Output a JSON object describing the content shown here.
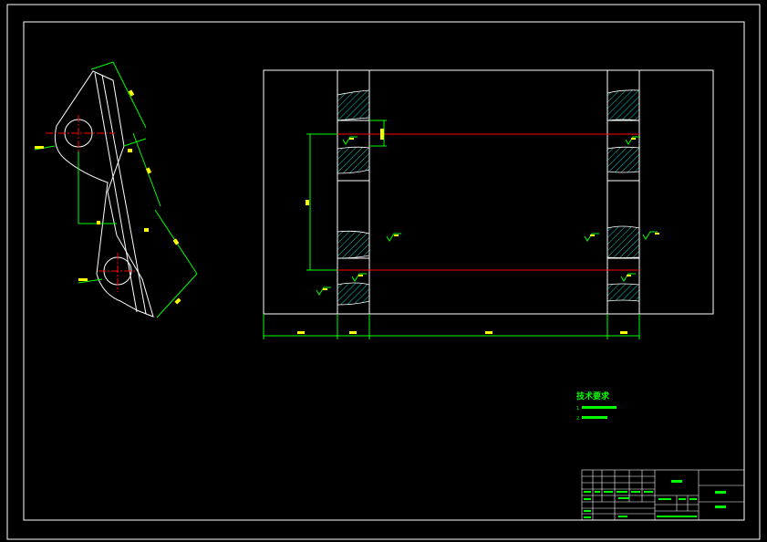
{
  "drawing": {
    "colors": {
      "background": "#000000",
      "frame": "#ffffff",
      "part_outline": "#ffffff",
      "dimension": "#00ff00",
      "centerline": "#ff0000",
      "dimension_text": "#ffff00",
      "hatch": "#00ffff"
    },
    "tech_requirements": {
      "title": "技术要求",
      "line1": "1.",
      "line2": "2."
    },
    "title_block": {
      "part_name": "",
      "material": "",
      "drawing_no": "",
      "row_label_1": "",
      "row_label_2": ""
    }
  }
}
